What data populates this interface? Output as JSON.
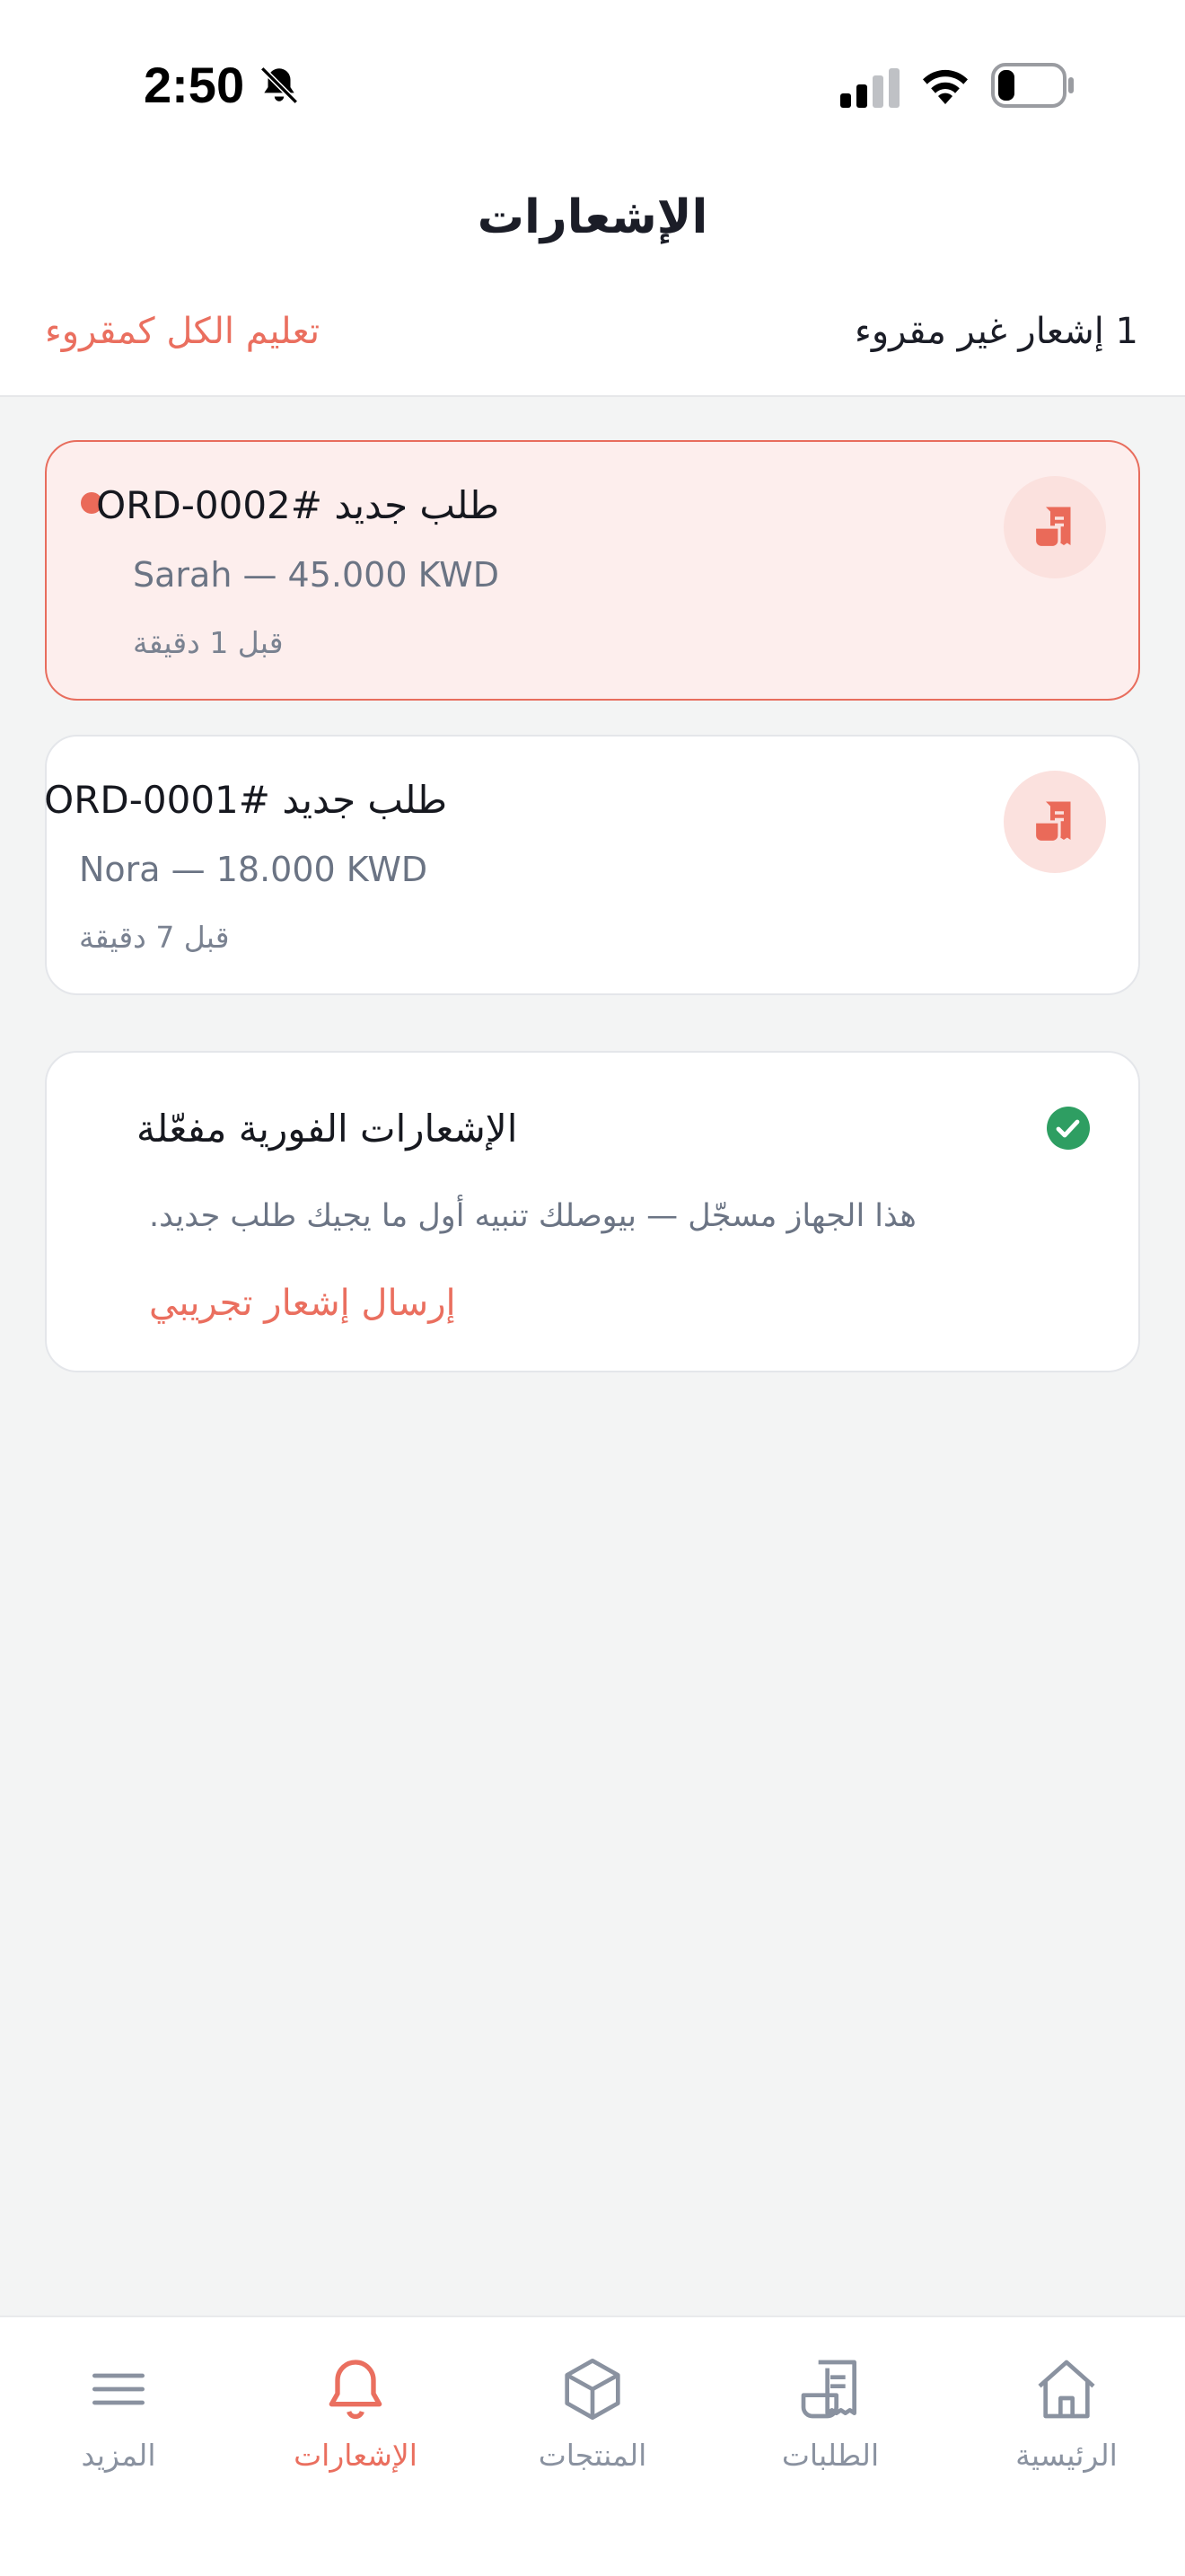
{
  "status_bar": {
    "time": "2:50"
  },
  "header": {
    "title": "الإشعارات",
    "unread_count_text": "1 إشعار غير مقروء",
    "mark_all_label": "تعليم الكل كمقروء"
  },
  "notifications": [
    {
      "title": "طلب جديد #ORD-0002",
      "subtitle": "Sarah — 45.000 KWD",
      "time": "قبل 1 دقيقة",
      "unread": true,
      "icon": "receipt-icon"
    },
    {
      "title": "طلب جديد #ORD-0001",
      "subtitle": "Nora — 18.000 KWD",
      "time": "قبل 7 دقيقة",
      "unread": false,
      "icon": "receipt-icon"
    }
  ],
  "push_card": {
    "title": "الإشعارات الفورية مفعّلة",
    "description": "هذا الجهاز مسجّل — بيوصلك تنبيه أول ما يجيك طلب جديد.",
    "test_label": "إرسال إشعار تجريبي"
  },
  "tab_bar": {
    "items": [
      {
        "label": "الرئيسية",
        "icon": "home-icon",
        "active": false
      },
      {
        "label": "الطلبات",
        "icon": "receipt-icon",
        "active": false
      },
      {
        "label": "المنتجات",
        "icon": "box-icon",
        "active": false
      },
      {
        "label": "الإشعارات",
        "icon": "bell-icon",
        "active": true
      },
      {
        "label": "المزيد",
        "icon": "menu-icon",
        "active": false
      }
    ]
  },
  "colors": {
    "accent": "#ea6f5f",
    "success": "#2e9e62",
    "unread_bg": "#fdeeed"
  }
}
